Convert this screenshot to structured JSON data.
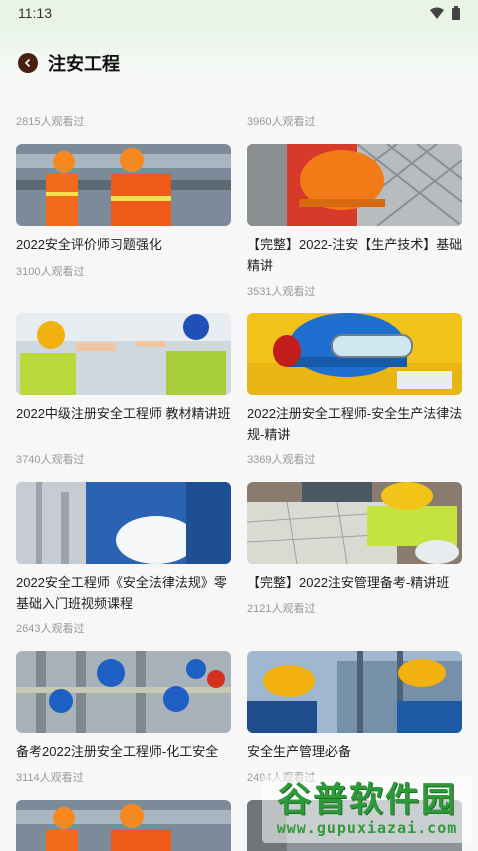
{
  "status": {
    "time": "11:13"
  },
  "header": {
    "title": "注安工程"
  },
  "top_views": [
    "2815人观看过",
    "3960人观看过"
  ],
  "courses": [
    {
      "title": "2022安全评价师习题强化",
      "views": "3100人观看过"
    },
    {
      "title": "【完整】2022-注安【生产技术】基础精讲",
      "views": "3531人观看过"
    },
    {
      "title": "2022中级注册安全工程师 教材精讲班",
      "views": "3740人观看过"
    },
    {
      "title": "2022注册安全工程师-安全生产法律法规-精讲",
      "views": "3369人观看过"
    },
    {
      "title": "2022安全工程师《安全法律法规》零基础入门班视频课程",
      "views": "2643人观看过"
    },
    {
      "title": "【完整】2022注安管理备考-精讲班",
      "views": "2121人观看过"
    },
    {
      "title": "备考2022注册安全工程师-化工安全",
      "views": "3114人观看过"
    },
    {
      "title": "安全生产管理必备",
      "views": "2494人观看过"
    }
  ],
  "watermark": {
    "cn": "谷普软件园",
    "url": "www.gupuxiazai.com"
  },
  "colors": {
    "accent": "#4a1f10",
    "header_bg": "#e9f4e7",
    "views_text": "#999999"
  }
}
